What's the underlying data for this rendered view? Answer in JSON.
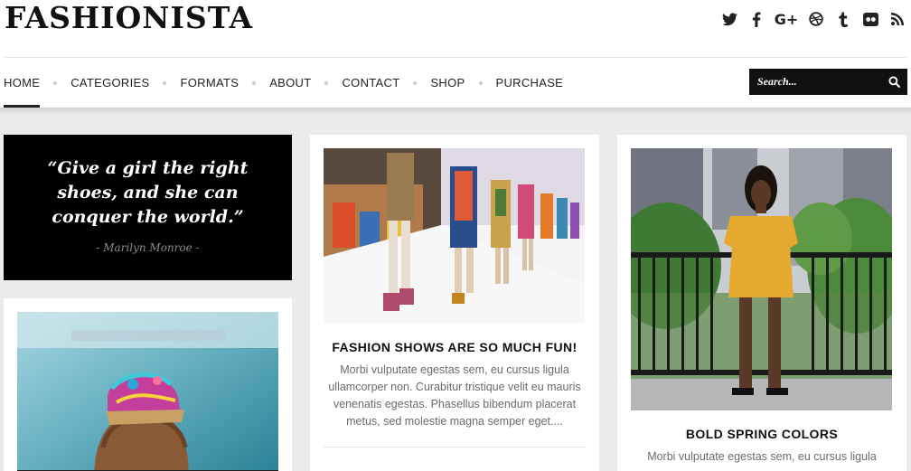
{
  "header": {
    "logo": "FASHIONISTA",
    "social": [
      "twitter-icon",
      "facebook-icon",
      "google-plus-icon",
      "dribbble-icon",
      "tumblr-icon",
      "flickr-icon",
      "rss-icon"
    ]
  },
  "nav": {
    "items": [
      "HOME",
      "CATEGORIES",
      "FORMATS",
      "ABOUT",
      "CONTACT",
      "SHOP",
      "PURCHASE"
    ],
    "active": "HOME"
  },
  "search": {
    "placeholder": "Search..."
  },
  "quote": {
    "text": "“Give a girl the right shoes, and she can conquer the world.”",
    "author": "- Marilyn Monroe -"
  },
  "posts": [
    {
      "title": "FASHION SHOWS ARE SO MUCH FUN!",
      "excerpt": "Morbi vulputate egestas sem, eu cursus ligula ullamcorper non. Curabitur tristique velit eu mauris venenatis egestas. Phasellus bibendum placerat metus, sed molestie magna semper eget...."
    },
    {
      "title": "BOLD SPRING COLORS",
      "excerpt": "Morbi vulputate egestas sem, eu cursus ligula"
    }
  ],
  "colors": {
    "accent": "#111111",
    "background": "#ebebeb",
    "text_muted": "#6b6b6b"
  }
}
